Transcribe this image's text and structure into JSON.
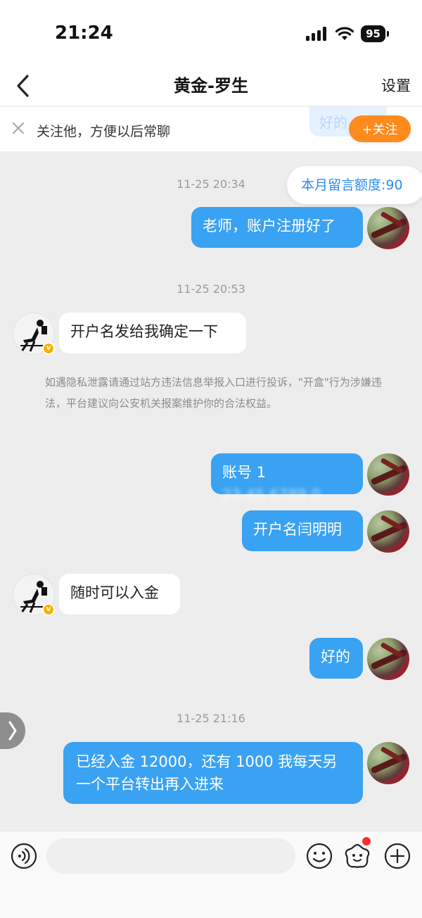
{
  "status_bar": {
    "time": "21:24",
    "battery": "95"
  },
  "nav": {
    "title": "黄金-罗生",
    "settings": "设置"
  },
  "follow_bar": {
    "text": "关注他，方便以后常聊",
    "button": "+关注",
    "ghost_text": "好的"
  },
  "quota": {
    "text": "本月留言额度:90"
  },
  "messages": [
    {
      "type": "timestamp",
      "text": "11-25 20:34"
    },
    {
      "type": "me",
      "text": "老师，账户注册好了"
    },
    {
      "type": "timestamp",
      "text": "11-25 20:53"
    },
    {
      "type": "peer",
      "text": "开户名发给我确定一下"
    },
    {
      "type": "notice",
      "text": "如遇隐私泄露请通过站方违法信息举报入口进行投诉，\"开盒\"行为涉嫌违法，平台建议向公安机关报案维护你的合法权益。"
    },
    {
      "type": "me",
      "text_prefix": "账号 1",
      "text_redacted": "23 45 6789 0"
    },
    {
      "type": "me",
      "text": "开户名闫明明"
    },
    {
      "type": "peer",
      "text": "随时可以入金"
    },
    {
      "type": "me",
      "text": "好的"
    },
    {
      "type": "timestamp",
      "text": "11-25 21:16"
    },
    {
      "type": "me",
      "text": "已经入金 12000，还有 1000 我每天另一个平台转出再入进来"
    }
  ],
  "input": {
    "placeholder": "",
    "value": ""
  },
  "icons": {
    "back": "chevron-left-icon",
    "close": "close-icon",
    "voice": "voice-icon",
    "emoji": "emoji-icon",
    "sticker": "sticker-icon",
    "plus": "plus-icon",
    "handle": "chevron-right-icon"
  },
  "colors": {
    "bubble_me": "#3aa2f3",
    "follow": "#ff8a1e",
    "quota_text": "#2d8cf0",
    "badge": "#f4b400"
  }
}
